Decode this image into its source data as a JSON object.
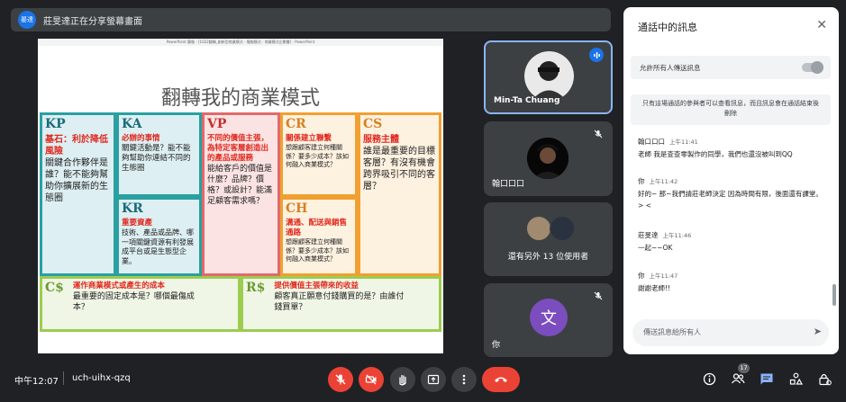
{
  "banner": {
    "avatar": "晏達",
    "text": "莊旻達正在分享螢幕畫面"
  },
  "slide": {
    "window_title": "PowerPoint 簡報 - [1022翻轉_創新型商業模式 - 簡報模式 - 商業模式企劃書] - PowerPoint",
    "title": "翻轉我的商業模式",
    "kp": {
      "code": "KP",
      "head": "基石：利於降低風險",
      "body": "關鍵合作夥伴是誰？能不能夠幫助你擴展新的生態圈"
    },
    "ka": {
      "code": "KA",
      "head": "必辦的事情",
      "body": "關鍵活動是？能不能夠幫助你連結不同的生態圈"
    },
    "kr": {
      "code": "KR",
      "head": "重要資產",
      "body": "技術、產品或品牌、哪一項關鍵資源有利發展成平台或是生態型企業。"
    },
    "vp": {
      "code": "VP",
      "head": "不同的價值主張，為特定客層創造出的產品或服務",
      "body": "能給客戶的價值是什麼？品牌？價格？或設計？能滿足顧客需求嗎？"
    },
    "cr": {
      "code": "CR",
      "head": "關係建立聯繫",
      "body": "想跟顧客建立何種關係？要多少成本？該如何融入商業模式？"
    },
    "ch": {
      "code": "CH",
      "head": "溝通、配送與銷售通路",
      "body": "想跟顧客建立何種關係？要多少成本？該如何融入商業模式？"
    },
    "cs": {
      "code": "CS",
      "head": "服務主體",
      "body": "誰是最重要的目標客層？有沒有機會跨界吸引不同的客層？"
    },
    "cost": {
      "code": "C$",
      "head": "運作商業模式或產生的成本",
      "body": "最重要的固定成本是？哪個最傷成本？"
    },
    "rev": {
      "code": "R$",
      "head": "提供價值主張帶來的收益",
      "body": "顧客真正願意付錢購買的是？由誰付錢買單？"
    }
  },
  "tiles": [
    {
      "name": "Min-Ta Chuang"
    },
    {
      "name": "翰口口口"
    },
    {
      "name": "還有另外 13 位使用者"
    },
    {
      "name": "你",
      "avatar_letter": "文"
    }
  ],
  "chat": {
    "title": "通話中的訊息",
    "toggle_label": "允許所有人傳送訊息",
    "note": "只有這場通話的參與者可以查看訊息，而且訊息會在通話結束後刪除",
    "messages": [
      {
        "who": "翰口口口",
        "time": "上午11:41",
        "body": "老師 我是查查零製作的同學，我們也還沒被叫到QQ"
      },
      {
        "who": "你",
        "time": "上午11:42",
        "body": "好的~ 那~我們請莊老師決定 因為時間有限，後面還有課堂。 > <"
      },
      {
        "who": "莊旻達",
        "time": "上午11:46",
        "body": "一起~~OK"
      },
      {
        "who": "你",
        "time": "上午11:47",
        "body": "謝謝老師!!"
      }
    ],
    "input_placeholder": "傳送訊息給所有人"
  },
  "bottom": {
    "clock": "中午12:07",
    "meeting_code": "uch-uihx-qzq",
    "participants_count": "17"
  },
  "colors": {
    "bg": "#202124",
    "accent": "#8ab4f8",
    "red": "#ea4335"
  }
}
